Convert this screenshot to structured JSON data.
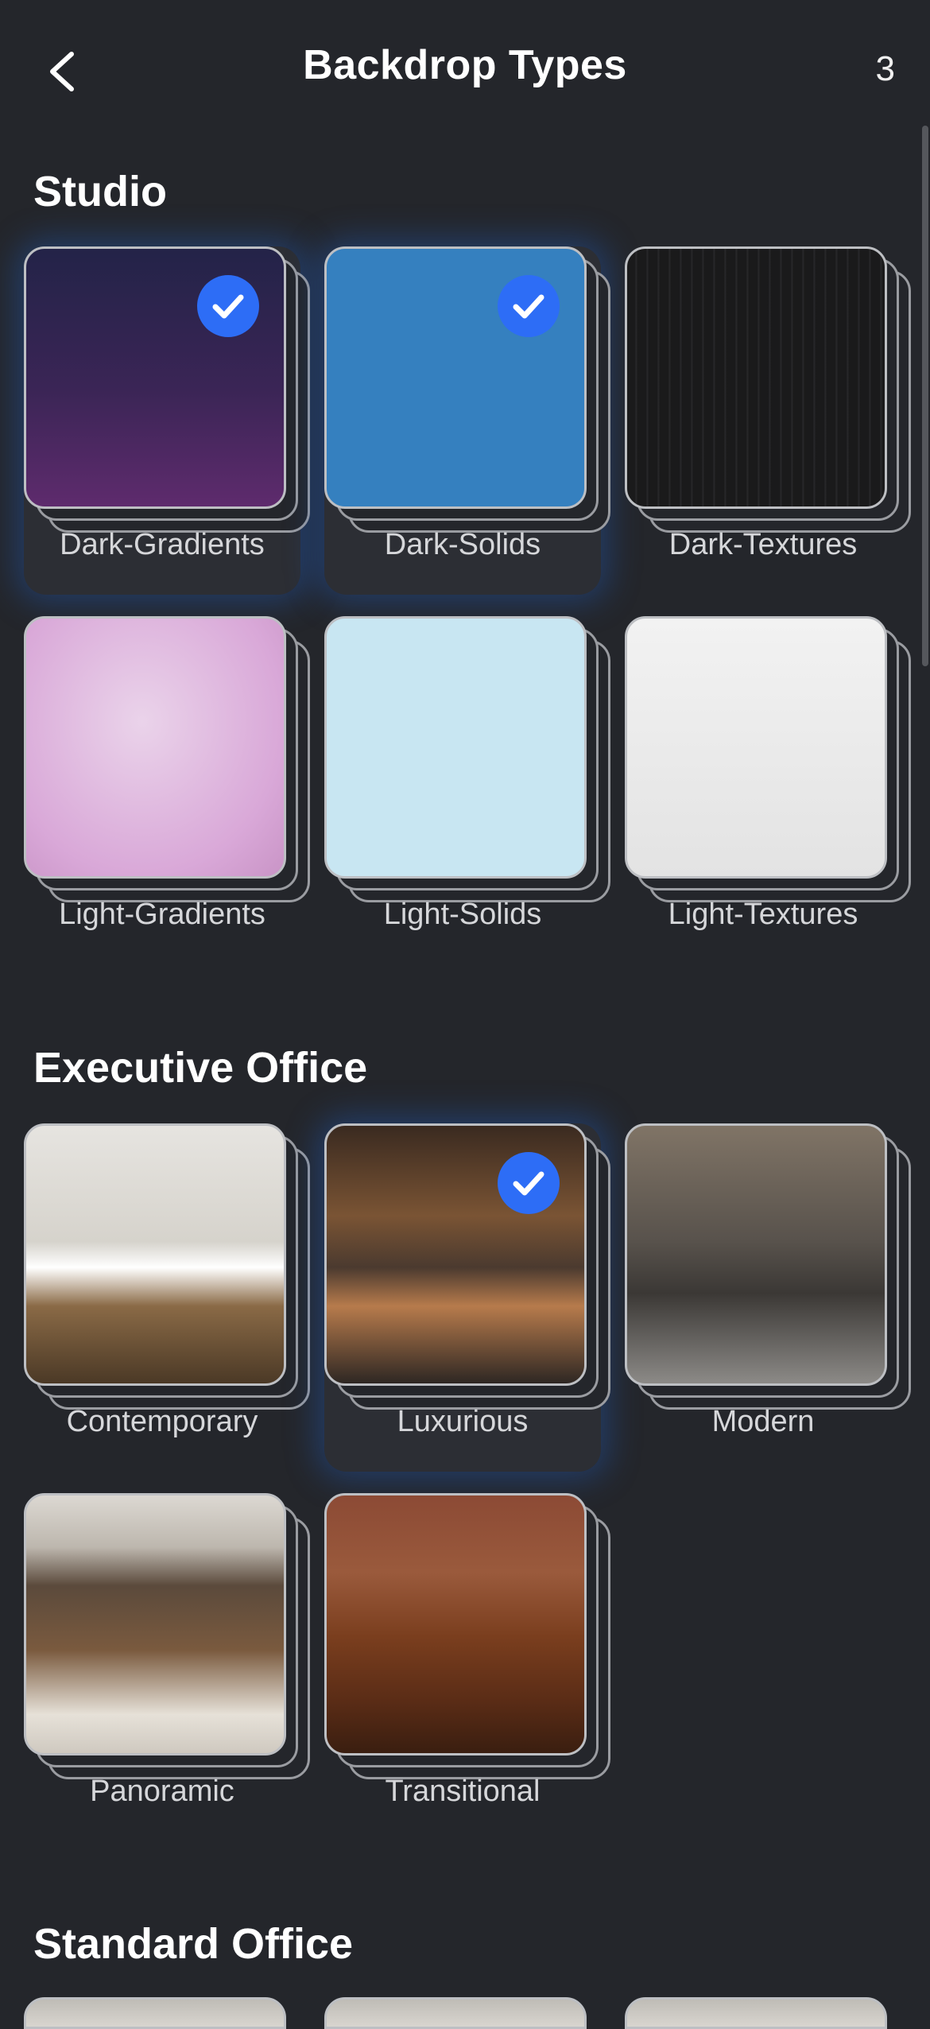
{
  "header": {
    "title": "Backdrop Types",
    "selected_count": "3"
  },
  "sections": [
    {
      "title": "Studio",
      "items": [
        {
          "label": "Dark-Gradients",
          "selected": true
        },
        {
          "label": "Dark-Solids",
          "selected": true
        },
        {
          "label": "Dark-Textures",
          "selected": false
        },
        {
          "label": "Light-Gradients",
          "selected": false
        },
        {
          "label": "Light-Solids",
          "selected": false
        },
        {
          "label": "Light-Textures",
          "selected": false
        }
      ]
    },
    {
      "title": "Executive Office",
      "items": [
        {
          "label": "Contemporary",
          "selected": false
        },
        {
          "label": "Luxurious",
          "selected": true
        },
        {
          "label": "Modern",
          "selected": false
        },
        {
          "label": "Panoramic",
          "selected": false
        },
        {
          "label": "Transitional",
          "selected": false
        }
      ]
    },
    {
      "title": "Standard Office",
      "items": []
    }
  ],
  "colors": {
    "background": "#24262b",
    "accent": "#2d6df6",
    "selected_glow": "#2262c9"
  },
  "icons": {
    "back": "chevron-left-icon",
    "check": "checkmark-icon"
  }
}
